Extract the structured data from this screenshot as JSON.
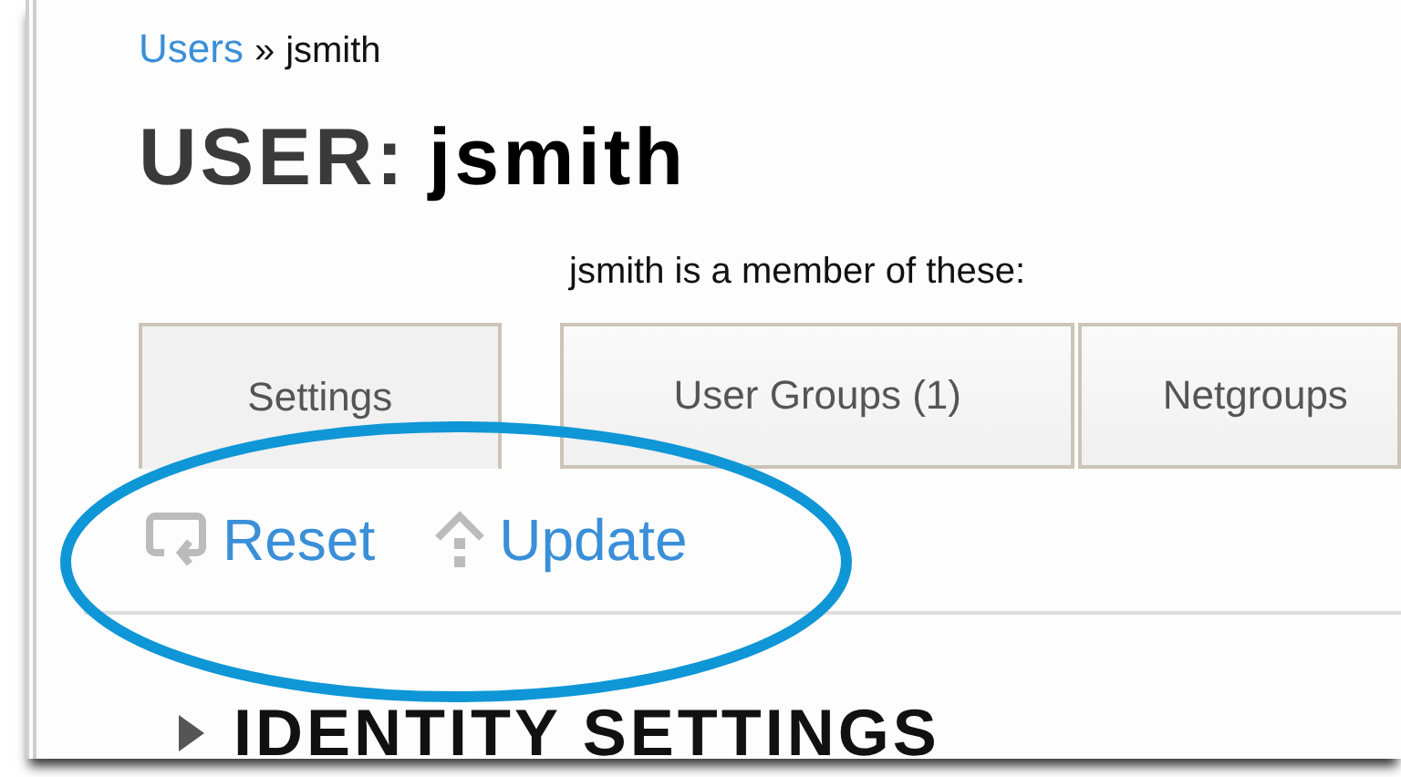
{
  "breadcrumb": {
    "link": "Users",
    "separator": "»",
    "current": "jsmith"
  },
  "title": {
    "prefix": "USER:",
    "name": "jsmith"
  },
  "membership_note": "jsmith is a member of these:",
  "tabs": [
    {
      "label": "Settings",
      "selected": true
    },
    {
      "label": "User Groups (1)",
      "selected": false
    },
    {
      "label": "Netgroups",
      "selected": false
    }
  ],
  "actions": [
    {
      "kind": "reset",
      "label": "Reset"
    },
    {
      "kind": "update",
      "label": "Update"
    }
  ],
  "section": {
    "title": "IDENTITY SETTINGS",
    "expanded": false
  }
}
